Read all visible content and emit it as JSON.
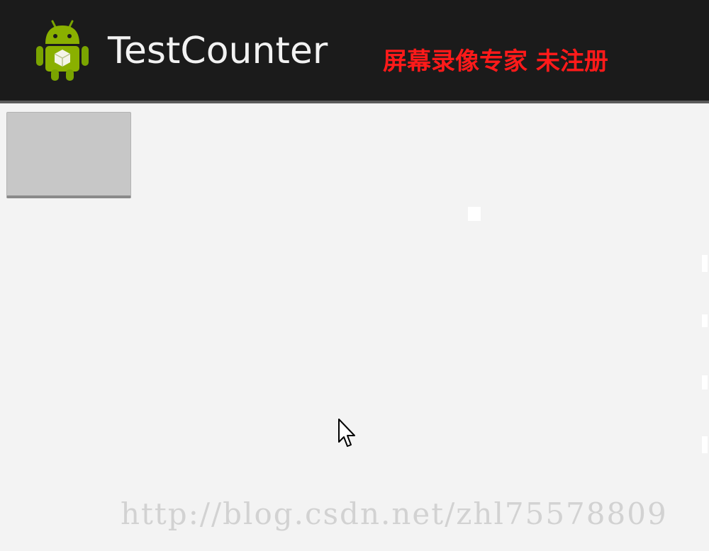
{
  "app": {
    "title": "TestCounter",
    "icon": "android-icon"
  },
  "overlay": {
    "recorder_watermark": "屏幕录像专家 未注册",
    "url_watermark": "http://blog.csdn.net/zhl75578809"
  },
  "cursor": {
    "icon": "mouse-pointer-icon"
  },
  "colors": {
    "action_bar": "#1b1b1b",
    "content_background": "#f3f3f3",
    "button_face": "#c7c7c7",
    "recorder_watermark": "#ff1a1a",
    "url_watermark": "#d2d2d2",
    "android_green": "#8ab000"
  }
}
